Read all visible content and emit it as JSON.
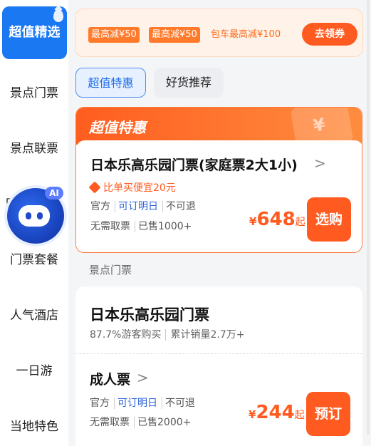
{
  "sidebar": {
    "items": [
      {
        "label": "超值精选"
      },
      {
        "label": "景点门票"
      },
      {
        "label": "景点联票"
      },
      {
        "label": "门票套餐"
      },
      {
        "label": "人气酒店"
      },
      {
        "label": "一日游"
      },
      {
        "label": "当地特色"
      }
    ],
    "partial_char": "园",
    "ai_badge": "AI"
  },
  "coupon_banner": {
    "chips": [
      "最高减¥50",
      "最高减¥50",
      "包车最高减¥100"
    ],
    "button": "去领券"
  },
  "tabs": [
    {
      "label": "超值特惠",
      "active": true
    },
    {
      "label": "好货推荐",
      "active": false
    }
  ],
  "deal": {
    "header": "超值特惠",
    "ticket_deco": "¥",
    "product": "日本乐高乐园门票(家庭票2大1小)",
    "chevron": ">",
    "savings": "比单买便宜20元",
    "tags": [
      "官方",
      "可订明日",
      "不可退"
    ],
    "meta": [
      "无需取票",
      "已售1000+"
    ],
    "currency": "¥",
    "price": "648",
    "price_suffix": "起",
    "buy_button": "选购"
  },
  "section_label": "景点门票",
  "ticket": {
    "park_name": "日本乐高乐园门票",
    "stats": [
      "87.7%游客购买",
      "累计销量2.7万+"
    ],
    "ticket_type": "成人票",
    "chevron": ">",
    "tags": [
      "官方",
      "可订明日",
      "不可退"
    ],
    "meta": [
      "无需取票",
      "已售2000+"
    ],
    "currency": "¥",
    "price": "244",
    "price_suffix": "起",
    "buy_button": "预订"
  },
  "colors": {
    "accent_orange": "#ff5a1f",
    "accent_blue": "#1a78f2"
  }
}
